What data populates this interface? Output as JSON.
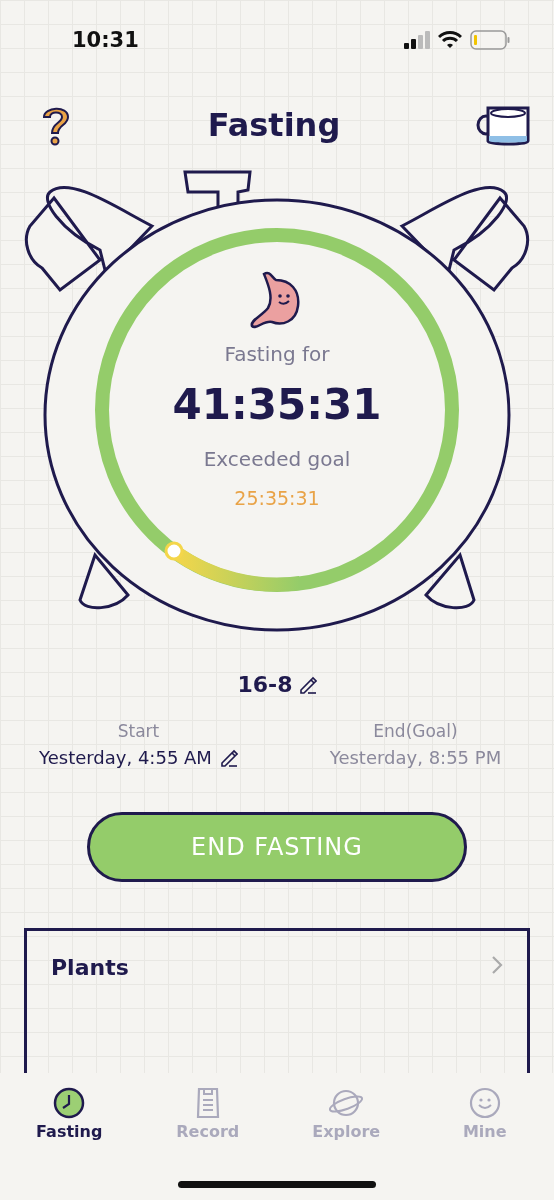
{
  "status_bar": {
    "time": "10:31"
  },
  "header": {
    "title": "Fasting"
  },
  "timer": {
    "label": "Fasting for",
    "elapsed": "41:35:31",
    "goal_label": "Exceeded goal",
    "goal_value": "25:35:31"
  },
  "plan": {
    "name": "16-8"
  },
  "times": [
    {
      "label": "Start",
      "value": "Yesterday, 4:55 AM",
      "editable": true
    },
    {
      "label": "End(Goal)",
      "value": "Yesterday, 8:55 PM",
      "editable": false
    }
  ],
  "action_button": "END FASTING",
  "card": {
    "title": "Plants"
  },
  "tabs": [
    {
      "label": "Fasting",
      "selected": true
    },
    {
      "label": "Record",
      "selected": false
    },
    {
      "label": "Explore",
      "selected": false
    },
    {
      "label": "Mine",
      "selected": false
    }
  ]
}
